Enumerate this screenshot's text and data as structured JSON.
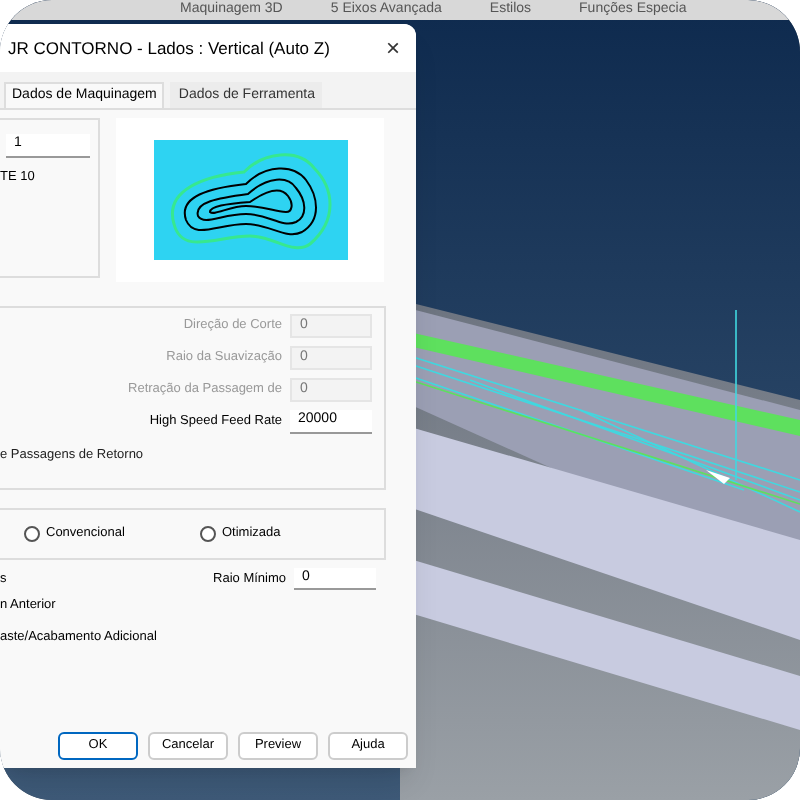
{
  "ribbon_tabs": [
    "Maquinagem 3D",
    "5 Eixos Avançada",
    "Estilos",
    "Funções Especia"
  ],
  "dialog": {
    "title": "JR CONTORNO - Lados : Vertical (Auto Z)",
    "close": "×",
    "tabs": [
      {
        "label": "Dados de Maquinagem",
        "selected": true
      },
      {
        "label": "Dados de Ferramenta",
        "selected": false
      }
    ],
    "top_group": {
      "field_value": "1",
      "label": "TE 10"
    },
    "parameters": [
      {
        "label": "Direção de Corte",
        "value": "0",
        "disabled": true
      },
      {
        "label": "Raio da Suavização",
        "value": "0",
        "disabled": true
      },
      {
        "label": "Retração da Passagem de",
        "value": "0",
        "disabled": true
      },
      {
        "label": "High Speed Feed Rate",
        "value": "20000",
        "disabled": false
      }
    ],
    "return_passes_label": "e Passagens de Retorno",
    "radios": [
      {
        "label": "Convencional",
        "selected": false
      },
      {
        "label": "Otimizada",
        "selected": false
      }
    ],
    "options": [
      "s",
      "n Anterior",
      "aste/Acabamento Adicional"
    ],
    "min_radius": {
      "label": "Raio Mínimo",
      "value": "0"
    },
    "buttons": [
      "OK",
      "Cancelar",
      "Preview",
      "Ajuda"
    ]
  }
}
